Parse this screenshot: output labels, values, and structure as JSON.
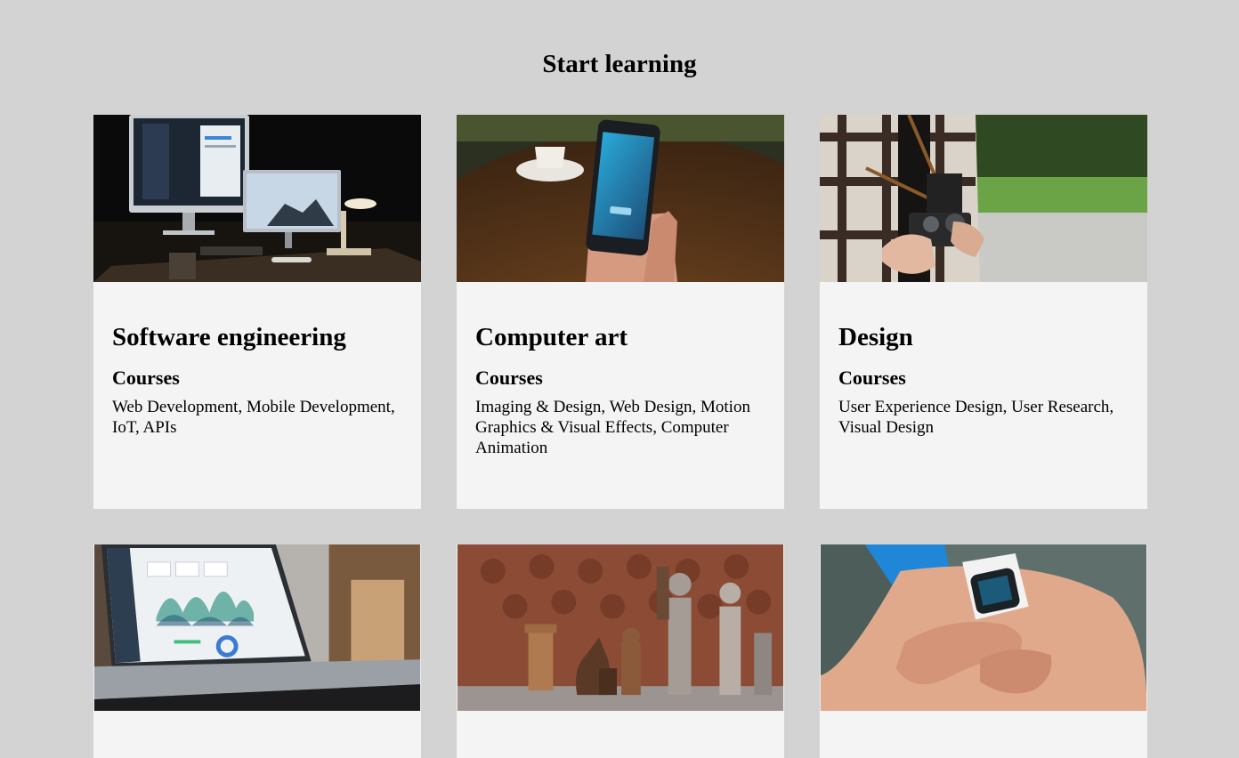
{
  "page": {
    "title": "Start learning"
  },
  "cards": [
    {
      "title": "Software engineering",
      "courses_label": "Courses",
      "courses": "Web Development, Mobile Development, IoT, APIs",
      "image": "desk-computers-photo"
    },
    {
      "title": "Computer art",
      "courses_label": "Courses",
      "courses": "Imaging & Design, Web Design, Motion Graphics & Visual Effects, Computer Animation",
      "image": "phone-in-hand-photo"
    },
    {
      "title": "Design",
      "courses_label": "Courses",
      "courses": "User Experience Design, User Research, Visual Design",
      "image": "camera-in-hands-photo"
    },
    {
      "image": "laptop-dashboard-photo"
    },
    {
      "image": "chess-pieces-photo"
    },
    {
      "image": "smartwatch-wrist-photo"
    }
  ],
  "colors": {
    "page_background": "#d3d3d3",
    "card_background": "#f4f4f4"
  }
}
